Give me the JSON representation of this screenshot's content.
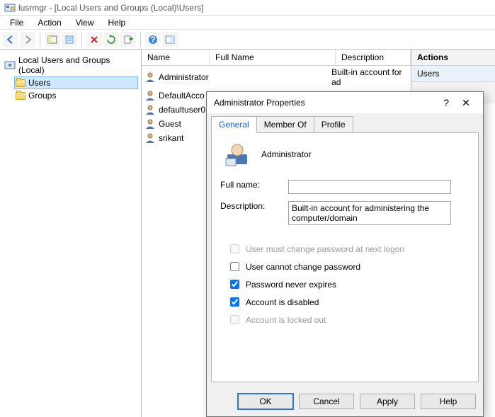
{
  "window": {
    "app_name": "lusrmgr",
    "path": "[Local Users and Groups (Local)\\Users]"
  },
  "menu": {
    "file": "File",
    "action": "Action",
    "view": "View",
    "help": "Help"
  },
  "tree": {
    "root": "Local Users and Groups (Local)",
    "users": "Users",
    "groups": "Groups"
  },
  "list": {
    "headers": {
      "name": "Name",
      "full": "Full Name",
      "desc": "Description"
    },
    "rows": [
      {
        "name": "Administrator",
        "full": "",
        "desc": "Built-in account for ad"
      },
      {
        "name": "DefaultAcco",
        "full": "",
        "desc": ""
      },
      {
        "name": "defaultuser0",
        "full": "",
        "desc": ""
      },
      {
        "name": "Guest",
        "full": "",
        "desc": ""
      },
      {
        "name": "srikant",
        "full": "",
        "desc": ""
      }
    ]
  },
  "actions": {
    "title": "Actions",
    "section": "Users"
  },
  "dialog": {
    "title": "Administrator Properties",
    "help_glyph": "?",
    "close_glyph": "✕",
    "tabs": {
      "general": "General",
      "memberof": "Member Of",
      "profile": "Profile"
    },
    "username": "Administrator",
    "labels": {
      "fullname": "Full name:",
      "description": "Description:"
    },
    "fields": {
      "fullname": "",
      "description": "Built-in account for administering the computer/domain"
    },
    "checks": {
      "must_change": "User must change password at next logon",
      "cannot_change": "User cannot change password",
      "never_expires": "Password never expires",
      "disabled": "Account is disabled",
      "locked": "Account is locked out"
    },
    "buttons": {
      "ok": "OK",
      "cancel": "Cancel",
      "apply": "Apply",
      "help": "Help"
    }
  }
}
